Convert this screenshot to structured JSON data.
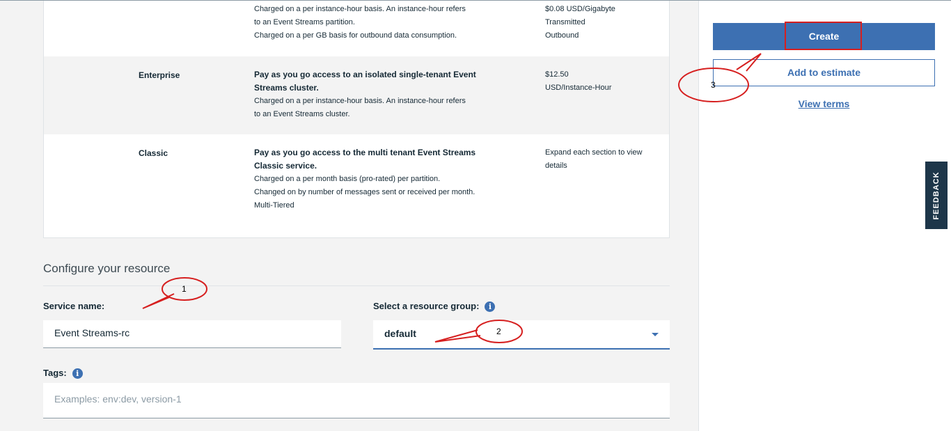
{
  "plans": [
    {
      "name": "",
      "lead": "",
      "details": [
        "Charged on a per instance-hour basis. An instance-hour refers",
        "to an Event Streams partition.",
        "Charged on a per GB basis for outbound data consumption."
      ],
      "price": [
        "$0.08 USD/Gigabyte",
        "Transmitted",
        "Outbound"
      ]
    },
    {
      "name": "Enterprise",
      "lead": "Pay as you go access to an isolated single-tenant Event Streams cluster.",
      "details": [
        "Charged on a per instance-hour basis. An instance-hour refers",
        "to an Event Streams cluster."
      ],
      "price": [
        "$12.50",
        "USD/Instance-Hour"
      ]
    },
    {
      "name": "Classic",
      "lead": "Pay as you go access to the multi tenant Event Streams Classic service.",
      "details": [
        "Charged on a per month basis (pro-rated) per partition.",
        "Changed on by number of messages sent or received per month.",
        "Multi-Tiered"
      ],
      "price": [
        "Expand each section to view details"
      ]
    }
  ],
  "configure": {
    "title": "Configure your resource",
    "service_name_label": "Service name:",
    "service_name_value": "Event Streams-rc",
    "resource_group_label": "Select a resource group:",
    "resource_group_value": "default",
    "tags_label": "Tags:",
    "tags_placeholder": "Examples: env:dev, version-1"
  },
  "sidebar": {
    "create_label": "Create",
    "estimate_label": "Add to estimate",
    "terms_label": "View terms"
  },
  "feedback_label": "FEEDBACK",
  "annotations": [
    "1",
    "2",
    "3"
  ],
  "colors": {
    "accent": "#3d70b2",
    "annotation": "#d61f1f",
    "feedback_bg": "#1d3649"
  },
  "icons": {
    "info": "info-icon",
    "caret": "chevron-down-icon"
  }
}
